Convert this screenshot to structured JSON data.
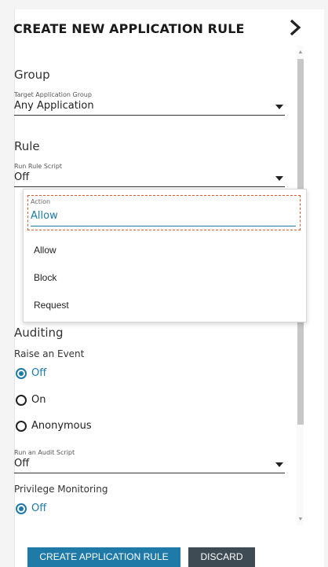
{
  "header": {
    "title": "CREATE NEW APPLICATION RULE"
  },
  "group": {
    "heading": "Group",
    "target_label": "Target Application Group",
    "target_value": "Any Application"
  },
  "rule": {
    "heading": "Rule",
    "script_label": "Run Rule Script",
    "script_value": "Off",
    "action_label": "Action",
    "action_value": "Allow",
    "action_options": [
      "Allow",
      "Block",
      "Request"
    ]
  },
  "auditing": {
    "heading": "Auditing",
    "raise_label": "Raise an Event",
    "raise_options": [
      "Off",
      "On",
      "Anonymous"
    ],
    "raise_selected": "Off",
    "audit_script_label": "Run an Audit Script",
    "audit_script_value": "Off",
    "priv_label": "Privilege Monitoring",
    "priv_selected": "Off"
  },
  "buttons": {
    "create": "CREATE APPLICATION RULE",
    "discard": "DISCARD"
  },
  "colors": {
    "accent": "#1f7aa8",
    "dark_button": "#3e4b55",
    "focus_outline": "#e05a2b"
  }
}
